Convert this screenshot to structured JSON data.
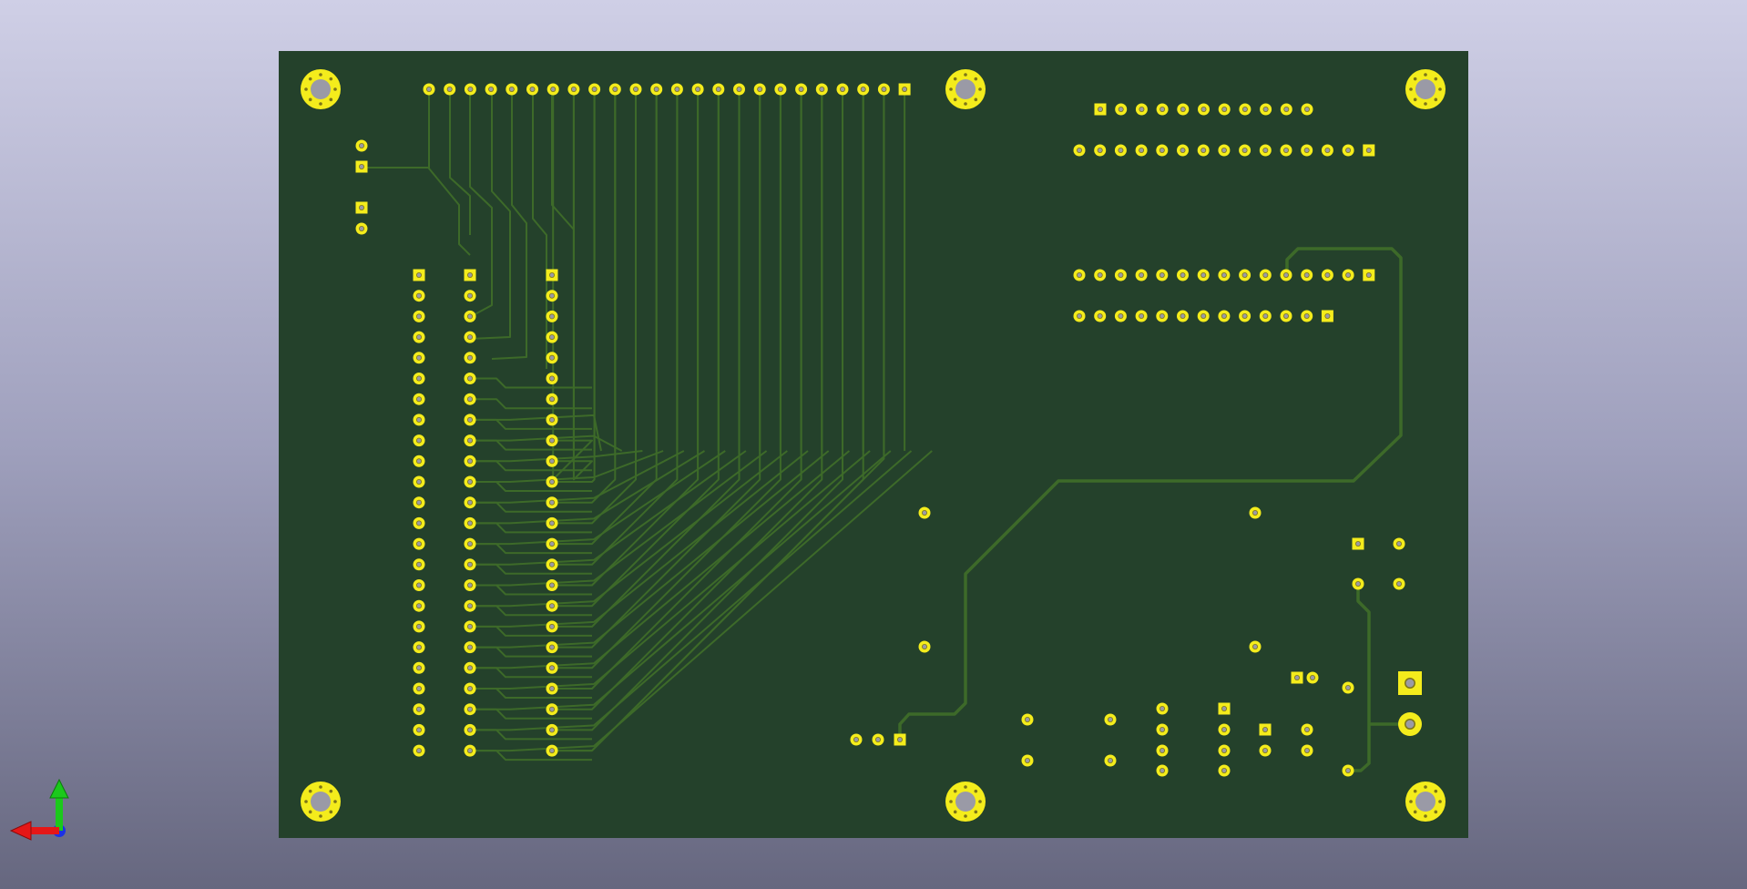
{
  "viewer": {
    "background_top": "#cfcfe6",
    "background_bottom": "#66677f"
  },
  "board": {
    "substrate_color": "#24412b",
    "pad_color": "#f4ec1c",
    "pad_ring_dark": "#7d7517",
    "trace_color": "#3d6a29",
    "hole_color": "#9a9aa6"
  },
  "axis_gizmo": {
    "x_axis_color": "#e51717",
    "y_axis_color": "#1bc91b",
    "z_axis_color": "#1c32e6"
  }
}
